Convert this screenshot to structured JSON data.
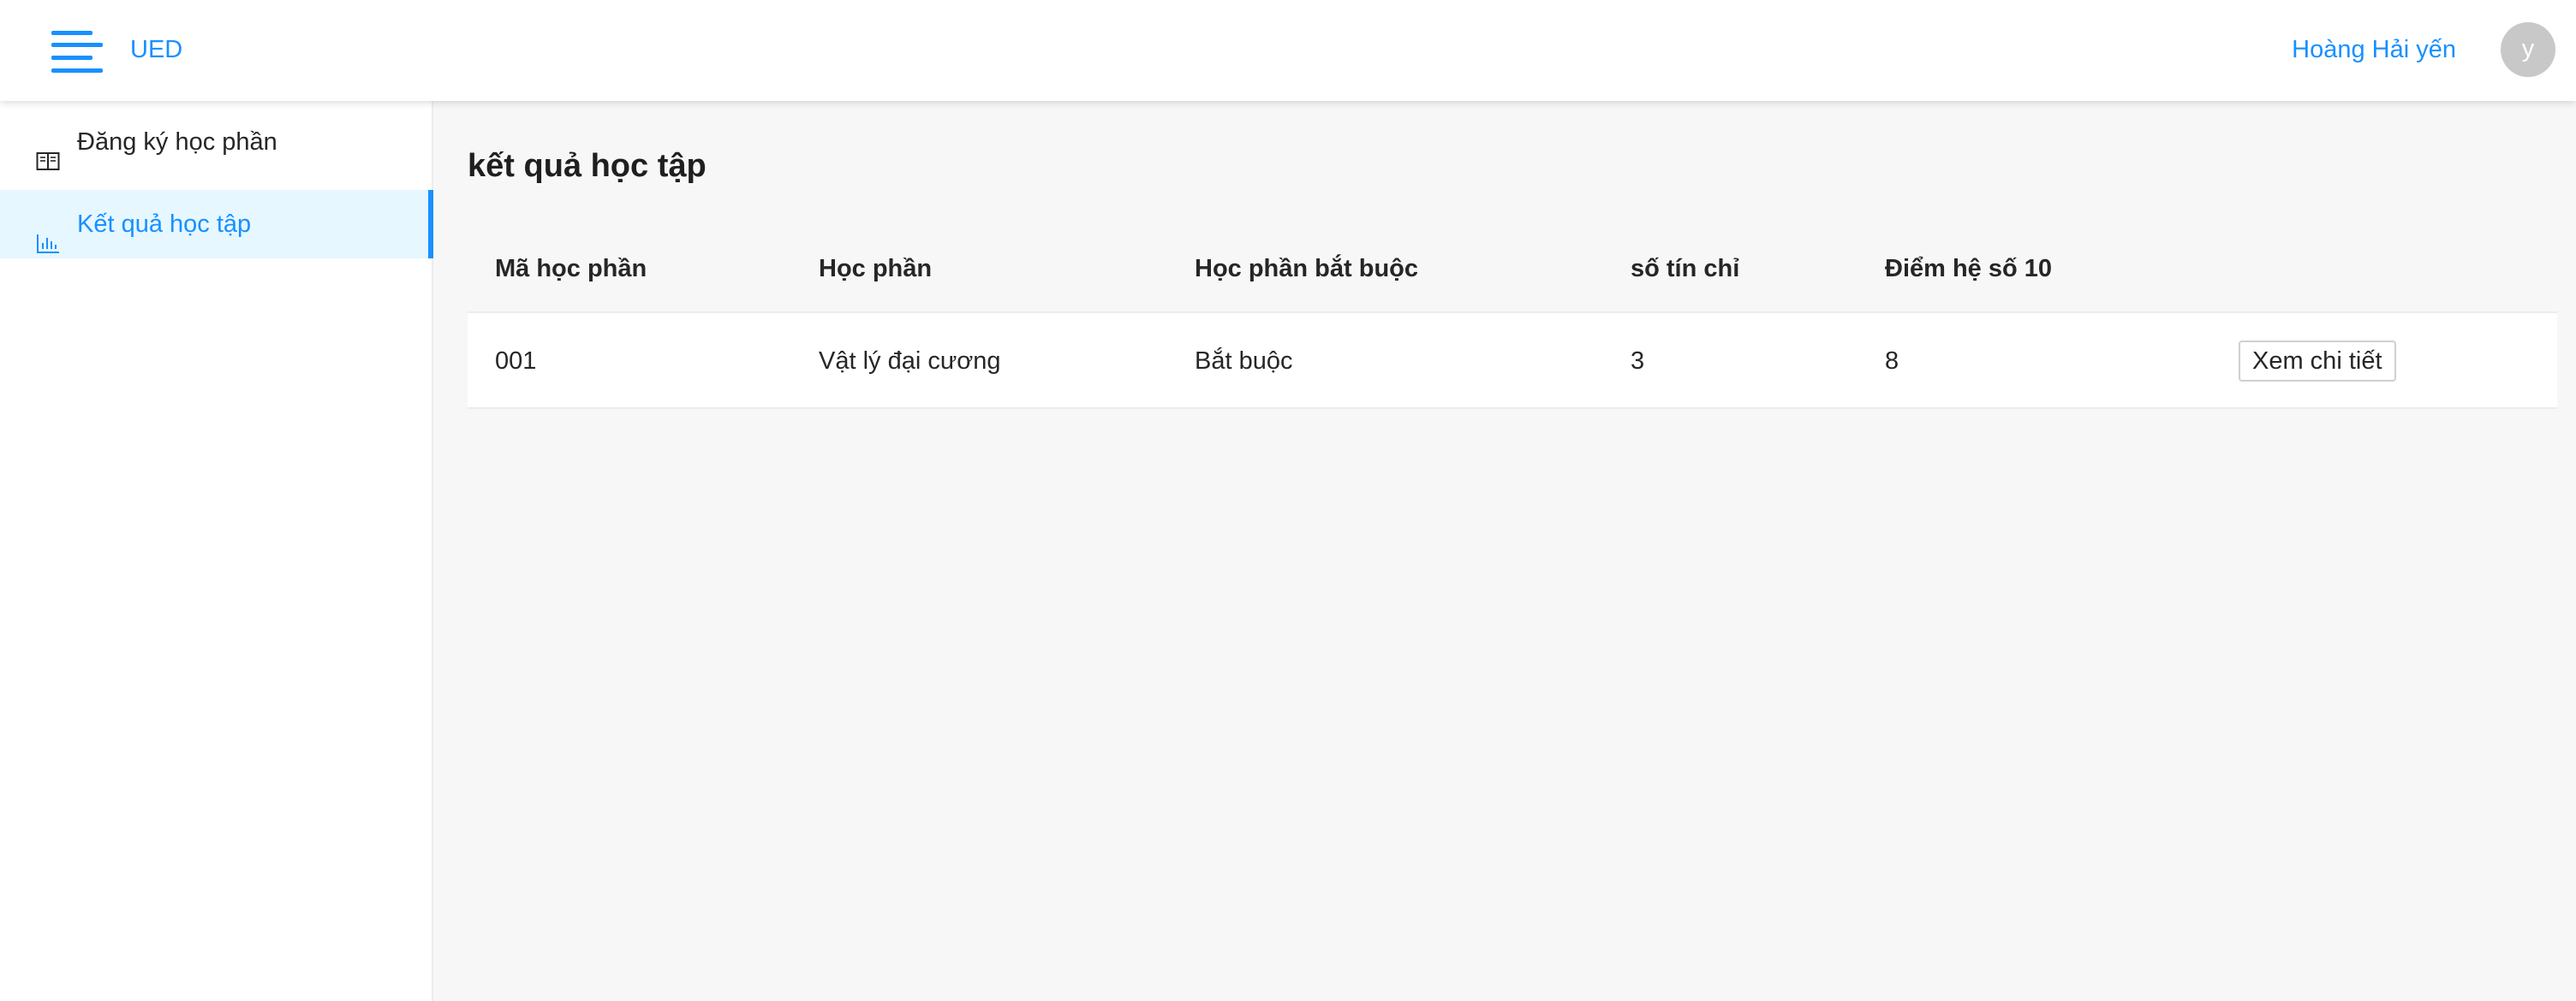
{
  "header": {
    "menu_icon": "menu-fold-icon",
    "brand": "UED",
    "user_name": "Hoàng Hải yến",
    "avatar_letter": "y",
    "accent_color": "#1890ff"
  },
  "sidebar": {
    "items": [
      {
        "label": "Đăng ký học phần",
        "icon": "book-icon",
        "active": false
      },
      {
        "label": "Kết quả học tập",
        "icon": "bar-chart-icon",
        "active": true
      }
    ]
  },
  "main": {
    "title": "kết quả học tập",
    "table": {
      "columns": [
        "Mã học phần",
        "Học phần",
        "Học phần bắt buộc",
        "số tín chỉ",
        "Điểm hệ số 10",
        ""
      ],
      "rows": [
        {
          "code": "001",
          "course": "Vật lý đại cương",
          "required": "Bắt buộc",
          "credits": "3",
          "score": "8",
          "action_label": "Xem chi tiết"
        }
      ]
    }
  }
}
